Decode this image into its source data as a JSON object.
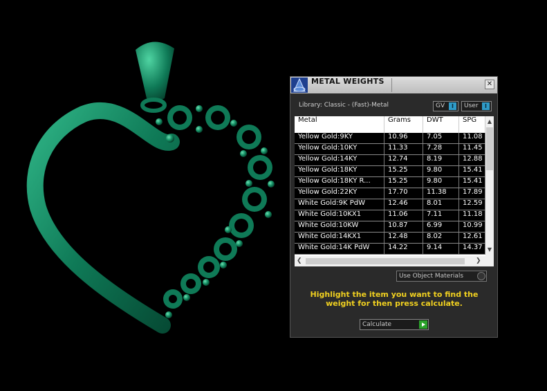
{
  "colors": {
    "pendant_green": "#0f7a57",
    "instruction_yellow": "#f0d020",
    "toggle_blue": "#2f9bc8",
    "calc_arrow_green": "#2aa32a"
  },
  "dialog": {
    "title": "METAL WEIGHTS",
    "close_symbol": "✕",
    "library_label": "Library: Classic - (Fast)-Metal",
    "toggle_gv": "GV",
    "toggle_user": "User",
    "toggle_indicator": "I",
    "columns": [
      "Metal",
      "Grams",
      "DWT",
      "SPG"
    ],
    "rows": [
      [
        "Yellow Gold:9KY",
        "10.96",
        "7.05",
        "11.08"
      ],
      [
        "Yellow Gold:10KY",
        "11.33",
        "7.28",
        "11.45"
      ],
      [
        "Yellow Gold:14KY",
        "12.74",
        "8.19",
        "12.88"
      ],
      [
        "Yellow Gold:18KY",
        "15.25",
        "9.80",
        "15.41"
      ],
      [
        "Yellow Gold:18KY R...",
        "15.25",
        "9.80",
        "15.41"
      ],
      [
        "Yellow Gold:22KY",
        "17.70",
        "11.38",
        "17.89"
      ],
      [
        "White Gold:9K PdW",
        "12.46",
        "8.01",
        "12.59"
      ],
      [
        "White Gold:10KX1",
        "11.06",
        "7.11",
        "11.18"
      ],
      [
        "White Gold:10KW",
        "10.87",
        "6.99",
        "10.99"
      ],
      [
        "White Gold:14KX1",
        "12.48",
        "8.02",
        "12.61"
      ],
      [
        "White Gold:14K PdW",
        "14.22",
        "9.14",
        "14.37"
      ]
    ],
    "use_object_materials": "Use Object Materials",
    "instructions": "Highlight the item you want to find the weight for then press calculate.",
    "calculate": "Calculate",
    "scroll_up": "▲",
    "scroll_down": "▼",
    "scroll_left": "❮",
    "scroll_right": "❯"
  }
}
